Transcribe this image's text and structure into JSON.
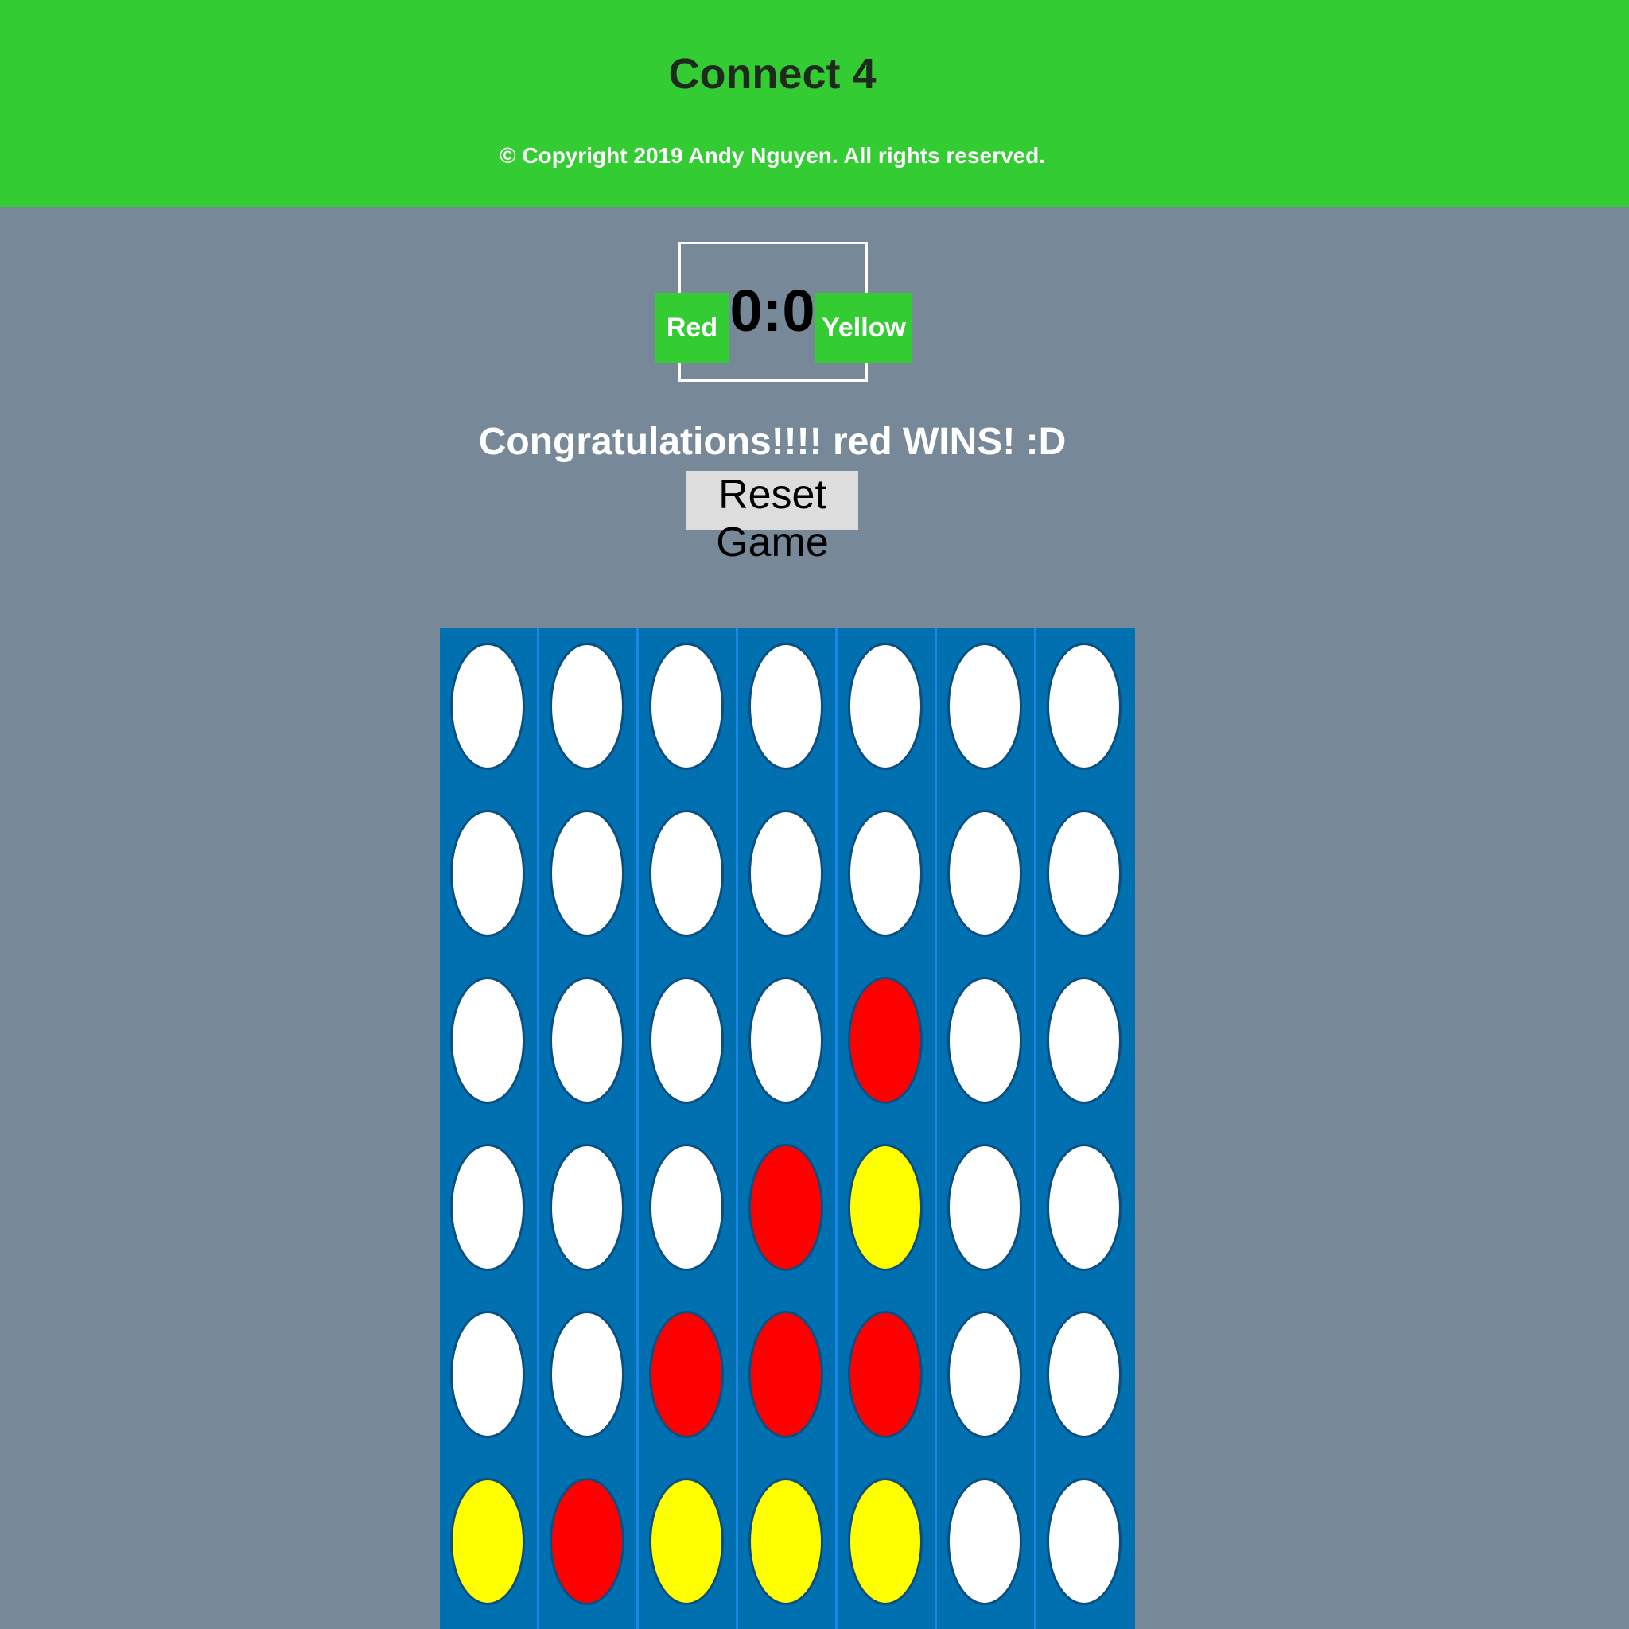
{
  "header": {
    "title": "Connect 4",
    "copyright": "© Copyright 2019 Andy Nguyen. All rights reserved.",
    "background_color": "#33cc33"
  },
  "scoreboard": {
    "red_label": "Red",
    "yellow_label": "Yellow",
    "score": "0:0"
  },
  "status": {
    "message": "Congratulations!!!! red WINS! :D"
  },
  "controls": {
    "reset_label": "Reset Game"
  },
  "board": {
    "columns": 7,
    "rows": 6,
    "board_color": "#0070b0",
    "colors": {
      "empty": "#ffffff",
      "red": "#ff0000",
      "yellow": "#ffff00"
    },
    "grid": [
      [
        "empty",
        "empty",
        "empty",
        "empty",
        "empty",
        "empty",
        "empty"
      ],
      [
        "empty",
        "empty",
        "empty",
        "empty",
        "empty",
        "empty",
        "empty"
      ],
      [
        "empty",
        "empty",
        "empty",
        "empty",
        "red",
        "empty",
        "empty"
      ],
      [
        "empty",
        "empty",
        "empty",
        "red",
        "yellow",
        "empty",
        "empty"
      ],
      [
        "empty",
        "empty",
        "red",
        "red",
        "red",
        "empty",
        "empty"
      ],
      [
        "yellow",
        "red",
        "yellow",
        "yellow",
        "yellow",
        "empty",
        "empty"
      ]
    ]
  }
}
